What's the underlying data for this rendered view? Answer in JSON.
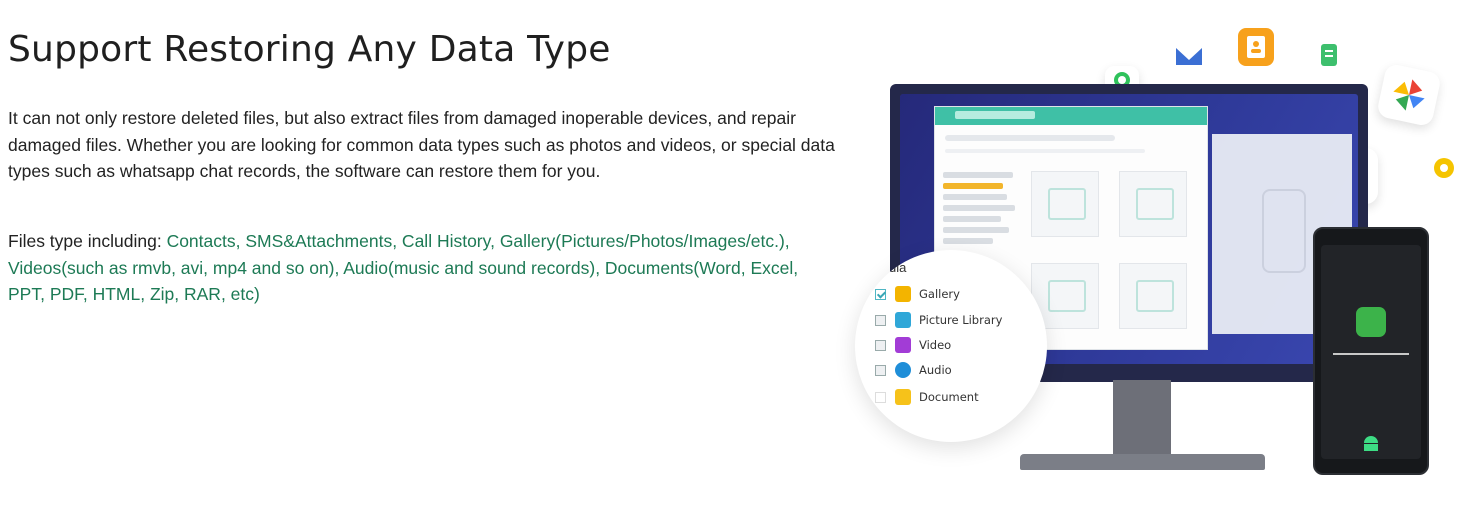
{
  "heading": "Support Restoring Any Data Type",
  "description": "It can not only restore deleted files, but also extract files from damaged inoperable devices, and repair damaged files. Whether you are looking for common data types such as photos and videos, or special data types such as whatsapp chat records, the software can restore them for you.",
  "files_type": {
    "prefix": "Files type including: ",
    "list": "Contacts, SMS&Attachments, Call History, Gallery(Pictures/Photos/Images/etc.), Videos(such as rmvb, avi, mp4 and so on), Audio(music and sound records), Documents(Word, Excel, PPT, PDF, HTML, Zip, RAR, etc)"
  },
  "illustration": {
    "circle_header": "dia",
    "items": [
      {
        "label": "Gallery",
        "checked": true,
        "icon": "gallery-icon",
        "color": "#f3b400"
      },
      {
        "label": "Picture Library",
        "checked": false,
        "icon": "picture-library-icon",
        "color": "#2fa7d8"
      },
      {
        "label": "Video",
        "checked": false,
        "icon": "video-icon",
        "color": "#a23cd6"
      },
      {
        "label": "Audio",
        "checked": false,
        "icon": "audio-icon",
        "color": "#1f8ed8"
      },
      {
        "label": "Document",
        "checked": false,
        "icon": "document-icon",
        "color": "#f6c21a"
      }
    ]
  },
  "colors": {
    "link_green": "#1d7a55",
    "accent_teal": "#3fc0a6"
  }
}
